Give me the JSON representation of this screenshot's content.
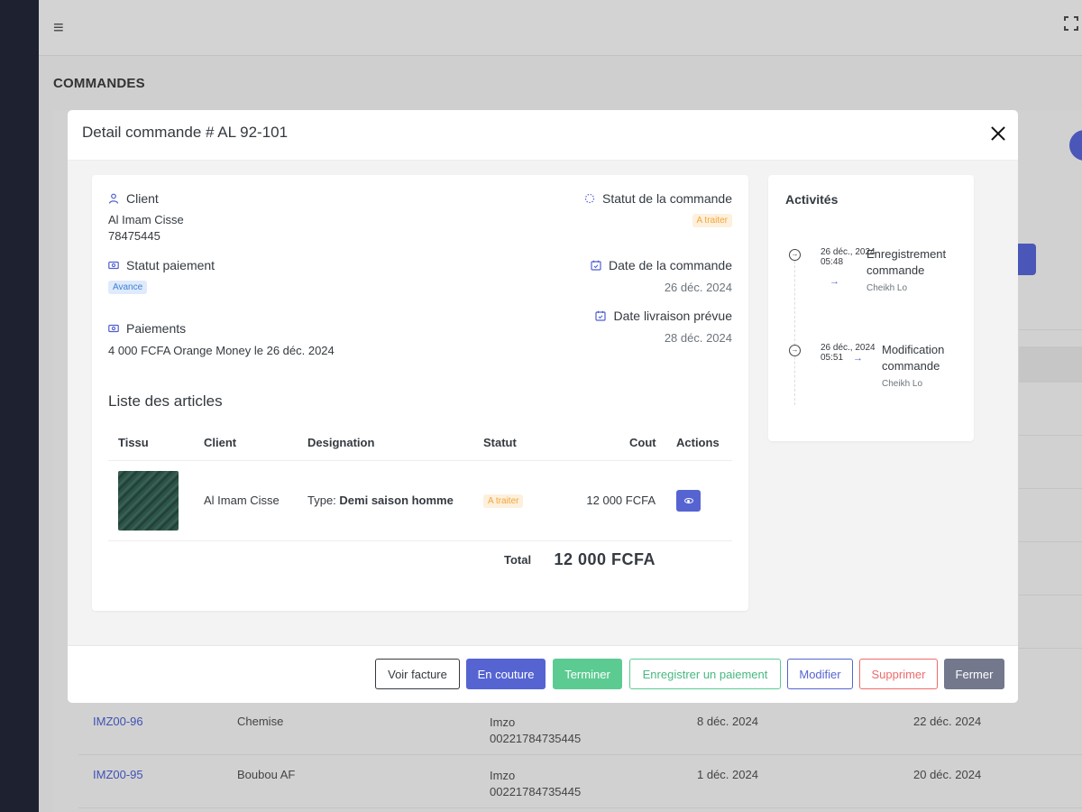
{
  "app": {
    "menu_icon": "hamburger-icon",
    "fullscreen_icon": "fullscreen-icon",
    "page_heading": "COMMANDES"
  },
  "background_table": {
    "rows": [
      {
        "code": "IMZ00-96",
        "type": "Chemise",
        "client_name": "Imzo",
        "client_phone": "00221784735445",
        "date1": "8 déc. 2024",
        "date2": "22 déc. 2024"
      },
      {
        "code": "IMZ00-95",
        "type": "Boubou AF",
        "client_name": "Imzo",
        "client_phone": "00221784735445",
        "date1": "1 déc. 2024",
        "date2": "20 déc. 2024"
      }
    ]
  },
  "modal": {
    "title": "Detail commande # AL 92-101",
    "client": {
      "label": "Client",
      "name": "Al Imam Cisse",
      "phone": "78475445"
    },
    "order_status": {
      "label": "Statut de la commande",
      "value": "A traiter"
    },
    "payment_status": {
      "label": "Statut paiement",
      "value": "Avance"
    },
    "order_date": {
      "label": "Date de la commande",
      "value": "26 déc. 2024"
    },
    "delivery_date": {
      "label": "Date livraison prévue",
      "value": "28 déc. 2024"
    },
    "payments": {
      "label": "Paiements",
      "value": "4 000 FCFA Orange Money le 26 déc. 2024"
    },
    "articles": {
      "title": "Liste des articles",
      "columns": [
        "Tissu",
        "Client",
        "Designation",
        "Statut",
        "Cout",
        "Actions"
      ],
      "rows": [
        {
          "client": "Al Imam Cisse",
          "designation_prefix": "Type:",
          "designation_value": "Demi saison homme",
          "status": "A traiter",
          "cost": "12 000 FCFA"
        }
      ],
      "total_label": "Total",
      "total_value": "12 000 FCFA"
    },
    "activities": {
      "title": "Activités",
      "items": [
        {
          "date": "26 déc., 2024",
          "time": "05:48",
          "text": "Enregistrement commande",
          "user": "Cheikh Lo"
        },
        {
          "date": "26 déc., 2024",
          "time": "05:51",
          "text": "Modification commande",
          "user": "Cheikh Lo"
        }
      ]
    },
    "footer": {
      "voir_facture": "Voir facture",
      "en_couture": "En couture",
      "terminer": "Terminer",
      "enregistrer_paiement": "Enregistrer un paiement",
      "modifier": "Modifier",
      "supprimer": "Supprimer",
      "fermer": "Fermer"
    }
  },
  "colors": {
    "primary": "#5664d2",
    "success": "#5ccb92",
    "danger": "#ee6b6b",
    "secondary": "#74788d",
    "warning": "#f4a537",
    "sidebar": "#1d2130"
  }
}
